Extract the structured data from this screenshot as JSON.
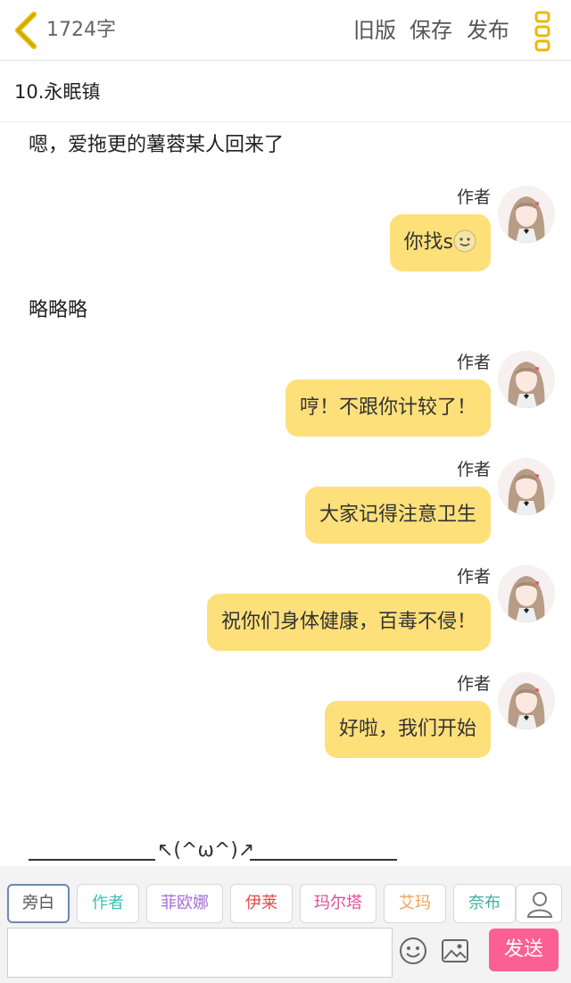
{
  "header": {
    "word_count": "1724字",
    "old_version": "旧版",
    "save": "保存",
    "publish": "发布"
  },
  "chapter": {
    "title": "10.永眠镇"
  },
  "messages": [
    {
      "type": "narration",
      "text": "嗯，爱拖更的薯蓉某人回来了"
    },
    {
      "type": "character",
      "sender": "作者",
      "text": "你找s",
      "emoji": "smile-emoji"
    },
    {
      "type": "narration",
      "text": "略略略"
    },
    {
      "type": "character",
      "sender": "作者",
      "text": "哼！不跟你计较了！"
    },
    {
      "type": "character",
      "sender": "作者",
      "text": "大家记得注意卫生"
    },
    {
      "type": "character",
      "sender": "作者",
      "text": "祝你们身体健康，百毒不侵！"
    },
    {
      "type": "character",
      "sender": "作者",
      "text": "好啦，我们开始"
    }
  ],
  "separator": {
    "face": "↖(^ω^)↗"
  },
  "roles": [
    {
      "label": "旁白",
      "color": "#666666"
    },
    {
      "label": "作者",
      "color": "#3bbfb5"
    },
    {
      "label": "菲欧娜",
      "color": "#a66cd6"
    },
    {
      "label": "伊莱",
      "color": "#e84a4a"
    },
    {
      "label": "玛尔塔",
      "color": "#e04c9a"
    },
    {
      "label": "艾玛",
      "color": "#f0a35a"
    },
    {
      "label": "奈布",
      "color": "#3fb0a0"
    }
  ],
  "input": {
    "value": "",
    "placeholder": ""
  },
  "send_label": "发送",
  "colors": {
    "bubble": "#fde07a",
    "send": "#fc5f94",
    "accent": "#e7b900"
  }
}
